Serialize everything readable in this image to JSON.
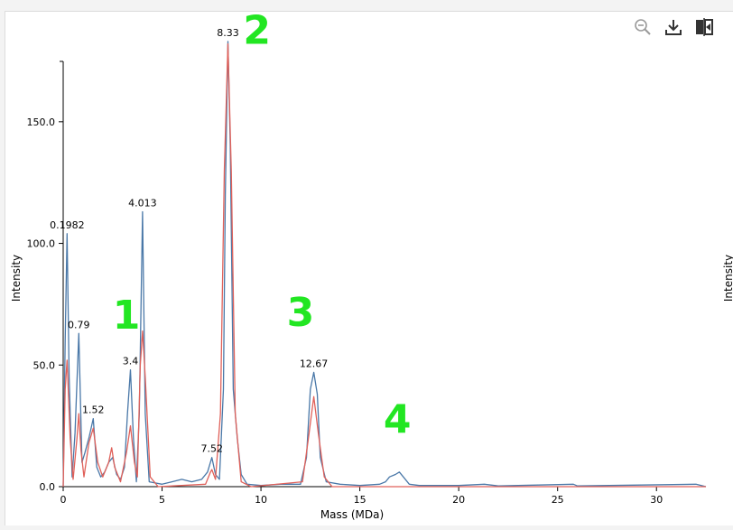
{
  "toolbar": {
    "zoom_out_icon": "zoom-out-icon",
    "download_icon": "download-icon",
    "compare_icon": "split-compare-icon"
  },
  "colors": {
    "raw_trace": "#4a78a8",
    "fit_trace": "#e0615a",
    "annotation": "#22e622",
    "axis": "#000000"
  },
  "chart_data": {
    "type": "line",
    "xlabel": "Mass (MDa)",
    "ylabel": "Intensity",
    "right_ylabel": "Intensity",
    "xlim": [
      0,
      32.5
    ],
    "ylim": [
      0,
      180
    ],
    "x_ticks": [
      "0",
      "5",
      "10",
      "15",
      "20",
      "25",
      "30"
    ],
    "y_ticks": [
      "0.0",
      "50.0",
      "100.0",
      "150.0"
    ],
    "grid": false,
    "series": [
      {
        "role": "raw",
        "points": [
          [
            0,
            0
          ],
          [
            0.1,
            60
          ],
          [
            0.1982,
            104
          ],
          [
            0.3,
            45
          ],
          [
            0.45,
            4
          ],
          [
            0.6,
            22
          ],
          [
            0.79,
            63
          ],
          [
            0.95,
            10
          ],
          [
            1.1,
            14
          ],
          [
            1.3,
            20
          ],
          [
            1.52,
            28
          ],
          [
            1.7,
            8
          ],
          [
            1.9,
            4
          ],
          [
            2.1,
            6
          ],
          [
            2.3,
            10
          ],
          [
            2.5,
            12
          ],
          [
            2.7,
            5
          ],
          [
            2.9,
            3
          ],
          [
            3.1,
            8
          ],
          [
            3.25,
            30
          ],
          [
            3.4,
            48
          ],
          [
            3.55,
            20
          ],
          [
            3.7,
            2
          ],
          [
            3.85,
            30
          ],
          [
            4.013,
            113
          ],
          [
            4.15,
            30
          ],
          [
            4.35,
            2
          ],
          [
            5.0,
            1
          ],
          [
            5.5,
            2
          ],
          [
            6.0,
            3
          ],
          [
            6.5,
            2
          ],
          [
            7.0,
            3
          ],
          [
            7.3,
            6
          ],
          [
            7.52,
            12
          ],
          [
            7.7,
            5
          ],
          [
            7.9,
            3
          ],
          [
            8.1,
            40
          ],
          [
            8.2,
            120
          ],
          [
            8.33,
            183
          ],
          [
            8.45,
            140
          ],
          [
            8.6,
            40
          ],
          [
            8.8,
            20
          ],
          [
            9.0,
            5
          ],
          [
            9.3,
            1
          ],
          [
            10,
            0.5
          ],
          [
            11,
            1
          ],
          [
            12.0,
            1
          ],
          [
            12.3,
            12
          ],
          [
            12.5,
            40
          ],
          [
            12.67,
            47
          ],
          [
            12.85,
            38
          ],
          [
            13.0,
            12
          ],
          [
            13.3,
            2
          ],
          [
            14,
            1
          ],
          [
            15,
            0.5
          ],
          [
            16.0,
            1
          ],
          [
            16.3,
            2
          ],
          [
            16.5,
            4
          ],
          [
            16.8,
            5
          ],
          [
            17.0,
            6
          ],
          [
            17.2,
            4
          ],
          [
            17.5,
            1
          ],
          [
            18,
            0.5
          ],
          [
            20,
            0.5
          ],
          [
            21.3,
            1
          ],
          [
            22,
            0.3
          ],
          [
            25.8,
            1
          ],
          [
            26,
            0.3
          ],
          [
            32,
            1
          ],
          [
            32.5,
            0
          ]
        ]
      },
      {
        "role": "fit",
        "points": [
          [
            0,
            0
          ],
          [
            0.1,
            40
          ],
          [
            0.1982,
            52
          ],
          [
            0.35,
            20
          ],
          [
            0.5,
            3
          ],
          [
            0.7,
            20
          ],
          [
            0.79,
            30
          ],
          [
            0.9,
            15
          ],
          [
            1.05,
            4
          ],
          [
            1.3,
            18
          ],
          [
            1.52,
            24
          ],
          [
            1.75,
            10
          ],
          [
            2.0,
            4
          ],
          [
            2.3,
            10
          ],
          [
            2.45,
            16
          ],
          [
            2.6,
            8
          ],
          [
            2.9,
            2
          ],
          [
            3.2,
            14
          ],
          [
            3.4,
            25
          ],
          [
            3.6,
            10
          ],
          [
            3.75,
            4
          ],
          [
            3.9,
            50
          ],
          [
            4.013,
            64
          ],
          [
            4.15,
            45
          ],
          [
            4.4,
            4
          ],
          [
            4.8,
            0
          ],
          [
            7.2,
            1
          ],
          [
            7.45,
            6
          ],
          [
            7.52,
            7
          ],
          [
            7.7,
            3
          ],
          [
            7.95,
            30
          ],
          [
            8.15,
            130
          ],
          [
            8.33,
            182
          ],
          [
            8.5,
            130
          ],
          [
            8.7,
            30
          ],
          [
            9.0,
            2
          ],
          [
            9.5,
            0
          ],
          [
            12.1,
            2
          ],
          [
            12.4,
            20
          ],
          [
            12.67,
            37
          ],
          [
            12.9,
            22
          ],
          [
            13.2,
            4
          ],
          [
            13.6,
            0
          ],
          [
            32.5,
            0
          ]
        ]
      }
    ],
    "data_labels": [
      {
        "x": 0.1982,
        "y": 104,
        "text": "0.1982"
      },
      {
        "x": 0.79,
        "y": 63,
        "text": "0.79"
      },
      {
        "x": 1.52,
        "y": 28,
        "text": "1.52"
      },
      {
        "x": 3.4,
        "y": 48,
        "text": "3.4"
      },
      {
        "x": 4.013,
        "y": 113,
        "text": "4.013"
      },
      {
        "x": 7.52,
        "y": 12,
        "text": "7.52"
      },
      {
        "x": 8.33,
        "y": 183,
        "text": "8.33"
      },
      {
        "x": 12.67,
        "y": 47,
        "text": "12.67"
      }
    ],
    "annotations": [
      {
        "text": "1",
        "x": 3.2,
        "y": 65
      },
      {
        "text": "2",
        "x": 9.8,
        "y": 182
      },
      {
        "text": "3",
        "x": 12.0,
        "y": 66
      },
      {
        "text": "4",
        "x": 16.9,
        "y": 22
      }
    ]
  }
}
